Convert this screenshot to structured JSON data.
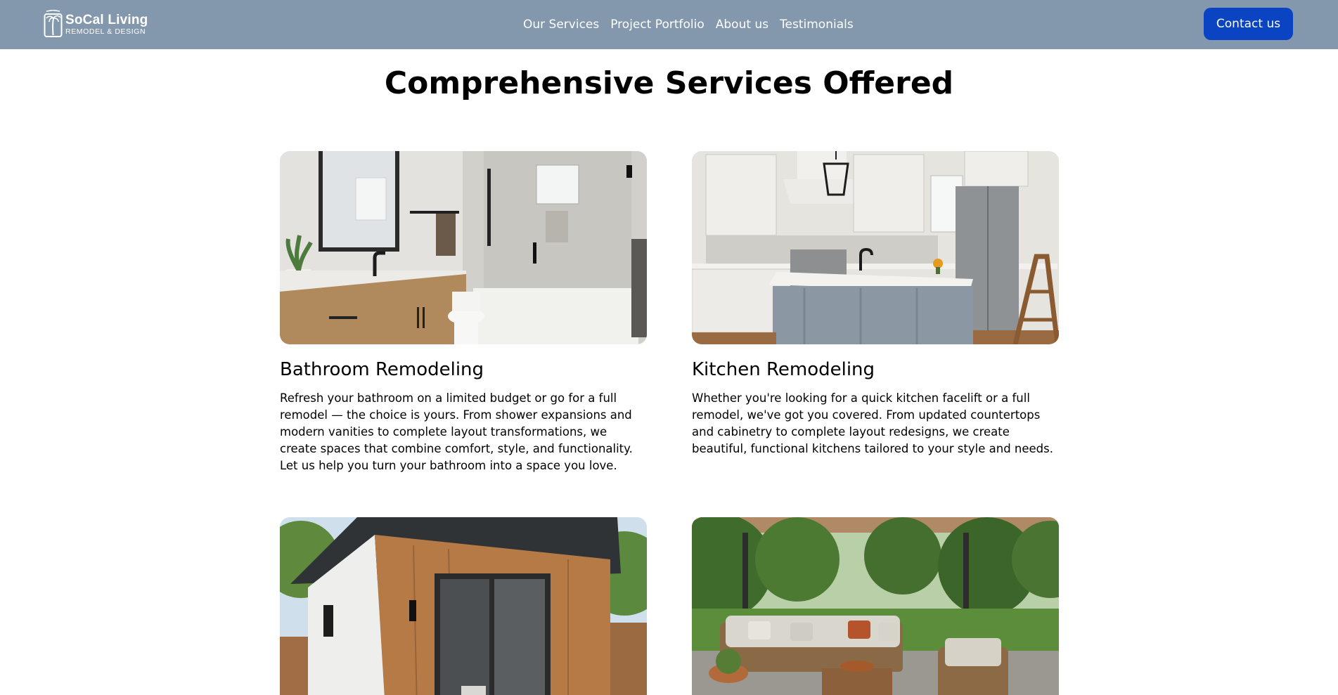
{
  "header": {
    "logo": {
      "title": "SoCal Living",
      "subtitle": "REMODEL & DESIGN",
      "icon": "palm-house-logo-icon"
    },
    "nav": [
      {
        "label": "Our Services"
      },
      {
        "label": "Project Portfolio"
      },
      {
        "label": "About us"
      },
      {
        "label": "Testimonials"
      }
    ],
    "contact_label": "Contact us",
    "colors": {
      "background": "#8397ad",
      "button": "#0a44c2"
    }
  },
  "main": {
    "title": "Comprehensive Services Offered",
    "services": [
      {
        "title": "Bathroom Remodeling",
        "description": "Refresh your bathroom on a limited budget or go for a full remodel — the choice is yours. From shower expansions and modern vanities to complete layout transformations, we create spaces that combine comfort, style, and functionality. Let us help you turn your bathroom into a space you love.",
        "image": "bathroom-photo"
      },
      {
        "title": "Kitchen Remodeling",
        "description": "Whether you're looking for a quick kitchen facelift or a full remodel, we've got you covered. From updated countertops and cabinetry to complete layout redesigns, we create beautiful, functional kitchens tailored to your style and needs.",
        "image": "kitchen-photo"
      },
      {
        "title": "",
        "description": "",
        "image": "adu-photo"
      },
      {
        "title": "",
        "description": "",
        "image": "patio-photo"
      }
    ]
  }
}
